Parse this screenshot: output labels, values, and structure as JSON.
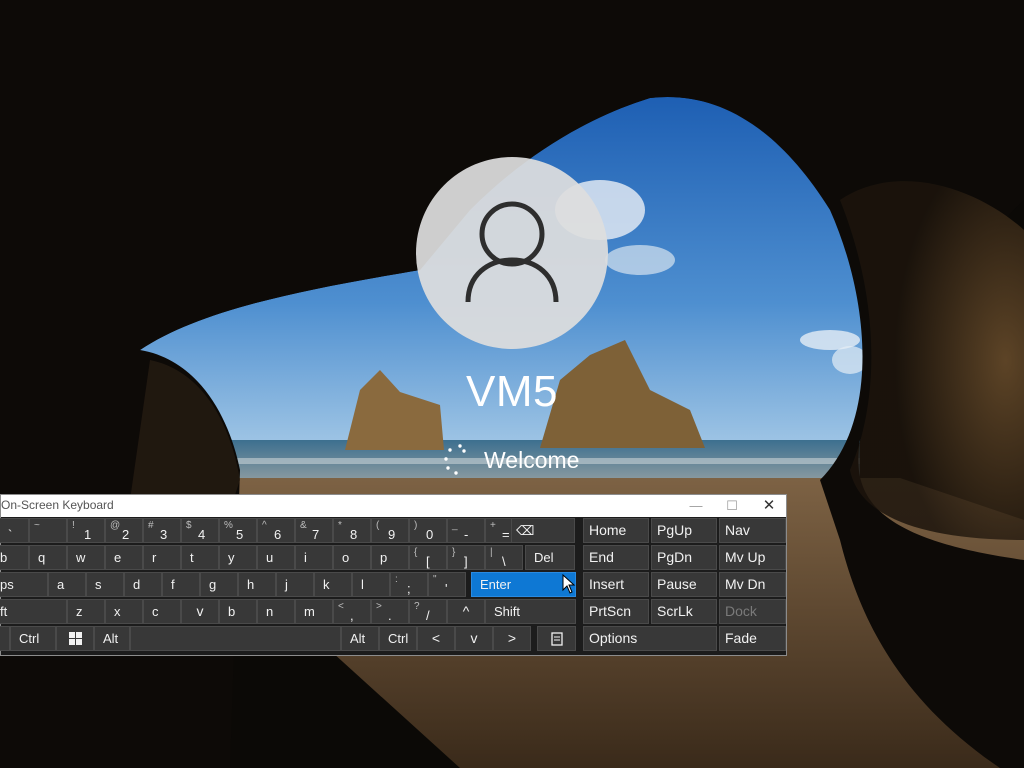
{
  "lock_screen": {
    "username": "VM5",
    "status_text": "Welcome"
  },
  "osk": {
    "title": "On-Screen Keyboard",
    "window_buttons": {
      "minimize": "—",
      "maximize": "☐",
      "close": "✕"
    },
    "rows": [
      [
        {
          "shift": "",
          "main": "`",
          "label": ""
        },
        {
          "shift": "~",
          "main": "",
          "label": ""
        },
        {
          "shift": "!",
          "main": "1",
          "label": ""
        },
        {
          "shift": "@",
          "main": "2",
          "label": ""
        },
        {
          "shift": "#",
          "main": "3",
          "label": ""
        },
        {
          "shift": "$",
          "main": "4",
          "label": ""
        },
        {
          "shift": "%",
          "main": "5",
          "label": ""
        },
        {
          "shift": "^",
          "main": "6",
          "label": ""
        },
        {
          "shift": "&",
          "main": "7",
          "label": ""
        },
        {
          "shift": "*",
          "main": "8",
          "label": ""
        },
        {
          "shift": "(",
          "main": "9",
          "label": ""
        },
        {
          "shift": ")",
          "main": "0",
          "label": ""
        },
        {
          "shift": "_",
          "main": "-",
          "label": ""
        },
        {
          "shift": "+",
          "main": "=",
          "label": ""
        },
        {
          "label": "⌫"
        }
      ],
      [
        {
          "label": "b"
        },
        {
          "label": "q"
        },
        {
          "label": "w"
        },
        {
          "label": "e"
        },
        {
          "label": "r"
        },
        {
          "label": "t"
        },
        {
          "label": "y"
        },
        {
          "label": "u"
        },
        {
          "label": "i"
        },
        {
          "label": "o"
        },
        {
          "label": "p"
        },
        {
          "shift": "{",
          "main": "["
        },
        {
          "shift": "}",
          "main": "]"
        },
        {
          "shift": "|",
          "main": "\\"
        },
        {
          "label": "Del"
        }
      ],
      [
        {
          "label": "ps"
        },
        {
          "label": "a"
        },
        {
          "label": "s"
        },
        {
          "label": "d"
        },
        {
          "label": "f"
        },
        {
          "label": "g"
        },
        {
          "label": "h"
        },
        {
          "label": "j"
        },
        {
          "label": "k"
        },
        {
          "label": "l"
        },
        {
          "shift": ":",
          "main": ";"
        },
        {
          "shift": "\"",
          "main": "'"
        },
        {
          "label": "Enter"
        }
      ],
      [
        {
          "label": "ft"
        },
        {
          "label": "z"
        },
        {
          "label": "x"
        },
        {
          "label": "c"
        },
        {
          "label": "v"
        },
        {
          "label": "b"
        },
        {
          "label": "n"
        },
        {
          "label": "m"
        },
        {
          "shift": "<",
          "main": ","
        },
        {
          "shift": ">",
          "main": "."
        },
        {
          "shift": "?",
          "main": "/"
        },
        {
          "label": "^"
        },
        {
          "label": "Shift"
        }
      ],
      [
        {
          "label": ""
        },
        {
          "label": "Ctrl"
        },
        {
          "label": "win"
        },
        {
          "label": "Alt"
        },
        {
          "label": ""
        },
        {
          "label": "Alt"
        },
        {
          "label": "Ctrl"
        },
        {
          "label": "<"
        },
        {
          "label": "v"
        },
        {
          "label": ">"
        },
        {
          "label": "menu"
        }
      ]
    ],
    "nav_keys": [
      [
        "Home",
        "PgUp",
        "Nav"
      ],
      [
        "End",
        "PgDn",
        "Mv Up"
      ],
      [
        "Insert",
        "Pause",
        "Mv Dn"
      ],
      [
        "PrtScn",
        "ScrLk",
        "Dock"
      ],
      [
        "Options",
        "",
        "Fade"
      ]
    ]
  },
  "icons": {
    "user": "user-icon",
    "spinner": "loading-spinner-icon",
    "backspace": "backspace-icon",
    "windows": "windows-logo-icon",
    "menu": "context-menu-icon",
    "cursor": "mouse-pointer-icon"
  },
  "colors": {
    "accent_key": "#0e78d4",
    "key_bg": "#383838",
    "osk_bg": "#1c1c1c"
  }
}
